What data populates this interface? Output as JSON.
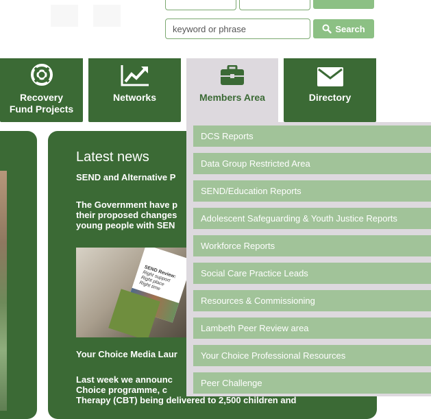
{
  "search": {
    "placeholder": "keyword or phrase",
    "button_label": "Search"
  },
  "nav": {
    "tiles": [
      {
        "label": "Recovery\nFund Projects",
        "icon": "lifebuoy-icon"
      },
      {
        "label": "Networks",
        "icon": "trend-chart-icon"
      },
      {
        "label": "Members Area",
        "icon": "briefcase-icon"
      },
      {
        "label": "Directory",
        "icon": "envelope-icon"
      }
    ]
  },
  "news": {
    "title": "Latest news",
    "item1_title": "SEND and Alternative P",
    "item1_body": [
      "The Government have p",
      "their proposed changes",
      "young people with SEN"
    ],
    "image_text": [
      "SEND Review:",
      "Right support",
      "Right place",
      "Right time"
    ],
    "item2_title": "Your Choice Media Laur",
    "item2_body": [
      "Last week we announc",
      "Choice programme, c",
      "Therapy (CBT) being delivered to 2,500 children and"
    ]
  },
  "dropdown": {
    "items": [
      "DCS Reports",
      "Data Group Restricted Area",
      "SEND/Education Reports",
      "Adolescent Safeguarding & Youth Justice Reports",
      "Workforce Reports",
      "Social Care Practice Leads",
      "Resources & Commissioning",
      "Lambeth Peer Review area",
      "Your Choice Professional Resources",
      "Peer Challenge"
    ]
  },
  "colors": {
    "nav_green": "#3b6a35",
    "button_green": "#8cc084",
    "dropdown_item": "#a1c399",
    "dropdown_bg": "#ddd9de"
  }
}
